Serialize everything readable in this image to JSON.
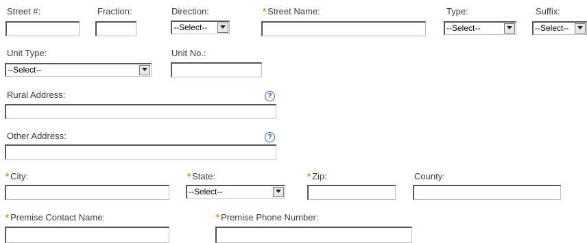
{
  "address_form": {
    "street_number": {
      "label": "Street #:",
      "value": ""
    },
    "fraction": {
      "label": "Fraction:",
      "value": ""
    },
    "direction": {
      "label": "Direction:",
      "selected": "--Select--"
    },
    "street_name": {
      "label": "Street Name:",
      "value": "",
      "required_marker": "*"
    },
    "type": {
      "label": "Type:",
      "selected": "--Select--"
    },
    "suffix": {
      "label": "Suffix:",
      "selected": "--Select--"
    },
    "unit_type": {
      "label": "Unit Type:",
      "selected": "--Select--"
    },
    "unit_no": {
      "label": "Unit No.:",
      "value": ""
    },
    "rural_address": {
      "label": "Rural Address:",
      "value": "",
      "help_glyph": "?"
    },
    "other_address": {
      "label": "Other Address:",
      "value": "",
      "help_glyph": "?"
    },
    "city": {
      "label": "City:",
      "value": "",
      "required_marker": "*"
    },
    "state": {
      "label": "State:",
      "selected": "--Select--",
      "required_marker": "*"
    },
    "zip": {
      "label": "Zip:",
      "value": "",
      "required_marker": "*"
    },
    "county": {
      "label": "County:",
      "value": ""
    },
    "premise_contact_name": {
      "label": "Premise Contact Name:",
      "value": "",
      "required_marker": "*"
    },
    "premise_phone_number": {
      "label": "Premise Phone Number:",
      "value": "",
      "required_marker": "*"
    }
  },
  "colors": {
    "required": "#f08a00",
    "help_icon": "#2a64c8",
    "label_text": "#3b3b3b"
  }
}
